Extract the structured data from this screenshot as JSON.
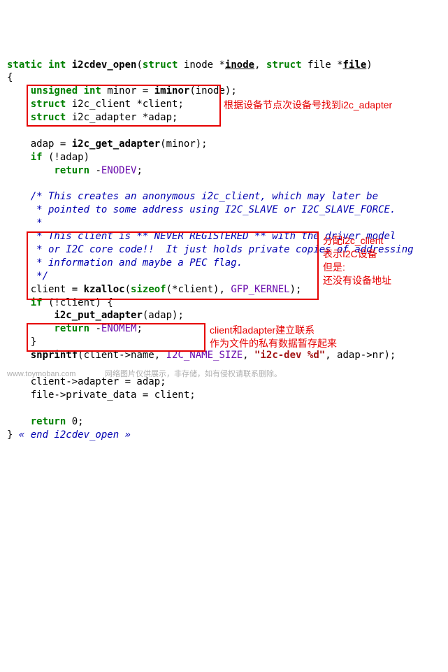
{
  "code": {
    "l1_kw1": "static",
    "l1_kw2": "int",
    "l1_func": "i2cdev_open",
    "l1_p1": "(",
    "l1_kw3": "struct",
    "l1_t1": " inode *",
    "l1_pu1": "inode",
    "l1_t2": ", ",
    "l1_kw4": "struct",
    "l1_t3": " file *",
    "l1_pu2": "file",
    "l1_t4": ")",
    "l2": "{",
    "l3_pre": "    ",
    "l3_kw1": "unsigned int",
    "l3_t1": " minor = ",
    "l3_call": "iminor",
    "l3_t2": "(inode);",
    "l4_pre": "    ",
    "l4_kw1": "struct",
    "l4_t1": " i2c_client *client;",
    "l5_pre": "    ",
    "l5_kw1": "struct",
    "l5_t1": " i2c_adapter *adap;",
    "blank1": "",
    "l7_pre": "    ",
    "l7_t1": "adap = ",
    "l7_call": "i2c_get_adapter",
    "l7_t2": "(minor);",
    "l8_pre": "    ",
    "l8_kw": "if",
    "l8_t1": " (!adap)",
    "l9_pre": "        ",
    "l9_kw": "return",
    "l9_t1": " -",
    "l9_en": "ENODEV",
    "l9_t2": ";",
    "blank2": "",
    "c1": "    /* This creates an anonymous i2c_client, which may later be",
    "c2": "     * pointed to some address using I2C_SLAVE or I2C_SLAVE_FORCE.",
    "c3": "     *",
    "c4": "     * This client is ** NEVER REGISTERED ** with the driver model",
    "c5": "     * or I2C core code!!  It just holds private copies of addressing",
    "c6": "     * information and maybe a PEC flag.",
    "c7": "     */",
    "l18_pre": "    ",
    "l18_t1": "client = ",
    "l18_call1": "kzalloc",
    "l18_t2": "(",
    "l18_call2": "sizeof",
    "l18_t3": "(*client), ",
    "l18_m": "GFP_KERNEL",
    "l18_t4": ");",
    "l19_pre": "    ",
    "l19_kw": "if",
    "l19_t1": " (!client) {",
    "l20_pre": "        ",
    "l20_call": "i2c_put_adapter",
    "l20_t1": "(adap);",
    "l21_pre": "        ",
    "l21_kw": "return",
    "l21_t1": " -",
    "l21_en": "ENOMEM",
    "l21_t2": ";",
    "l22_pre": "    ",
    "l22_t1": "}",
    "l23_pre": "    ",
    "l23_call": "snprintf",
    "l23_t1": "(client->name, ",
    "l23_m": "I2C_NAME_SIZE",
    "l23_t2": ", ",
    "l23_str": "\"i2c-dev %d\"",
    "l23_t3": ", adap->nr);",
    "blank3": "",
    "l25_pre": "    ",
    "l25_t1": "client->adapter = adap;",
    "l26_pre": "    ",
    "l26_t1": "file->private_data = client;",
    "blank4": "",
    "l28_pre": "    ",
    "l28_kw": "return",
    "l28_t1": " 0;",
    "l29_t1": "} ",
    "l29_c": "« end i2cdev_open »"
  },
  "annotations": {
    "a1": "根据设备节点次设备号找到i2c_adapter",
    "a2": "分配i2c_client\n表示I2C设备\n但是:\n还没有设备地址",
    "a3": "client和adapter建立联系\n作为文件的私有数据暂存起来"
  },
  "watermarks": {
    "w1": "www.toymoban.com",
    "w2": "网络图片仅供展示，非存储，如有侵权请联系删除。"
  }
}
